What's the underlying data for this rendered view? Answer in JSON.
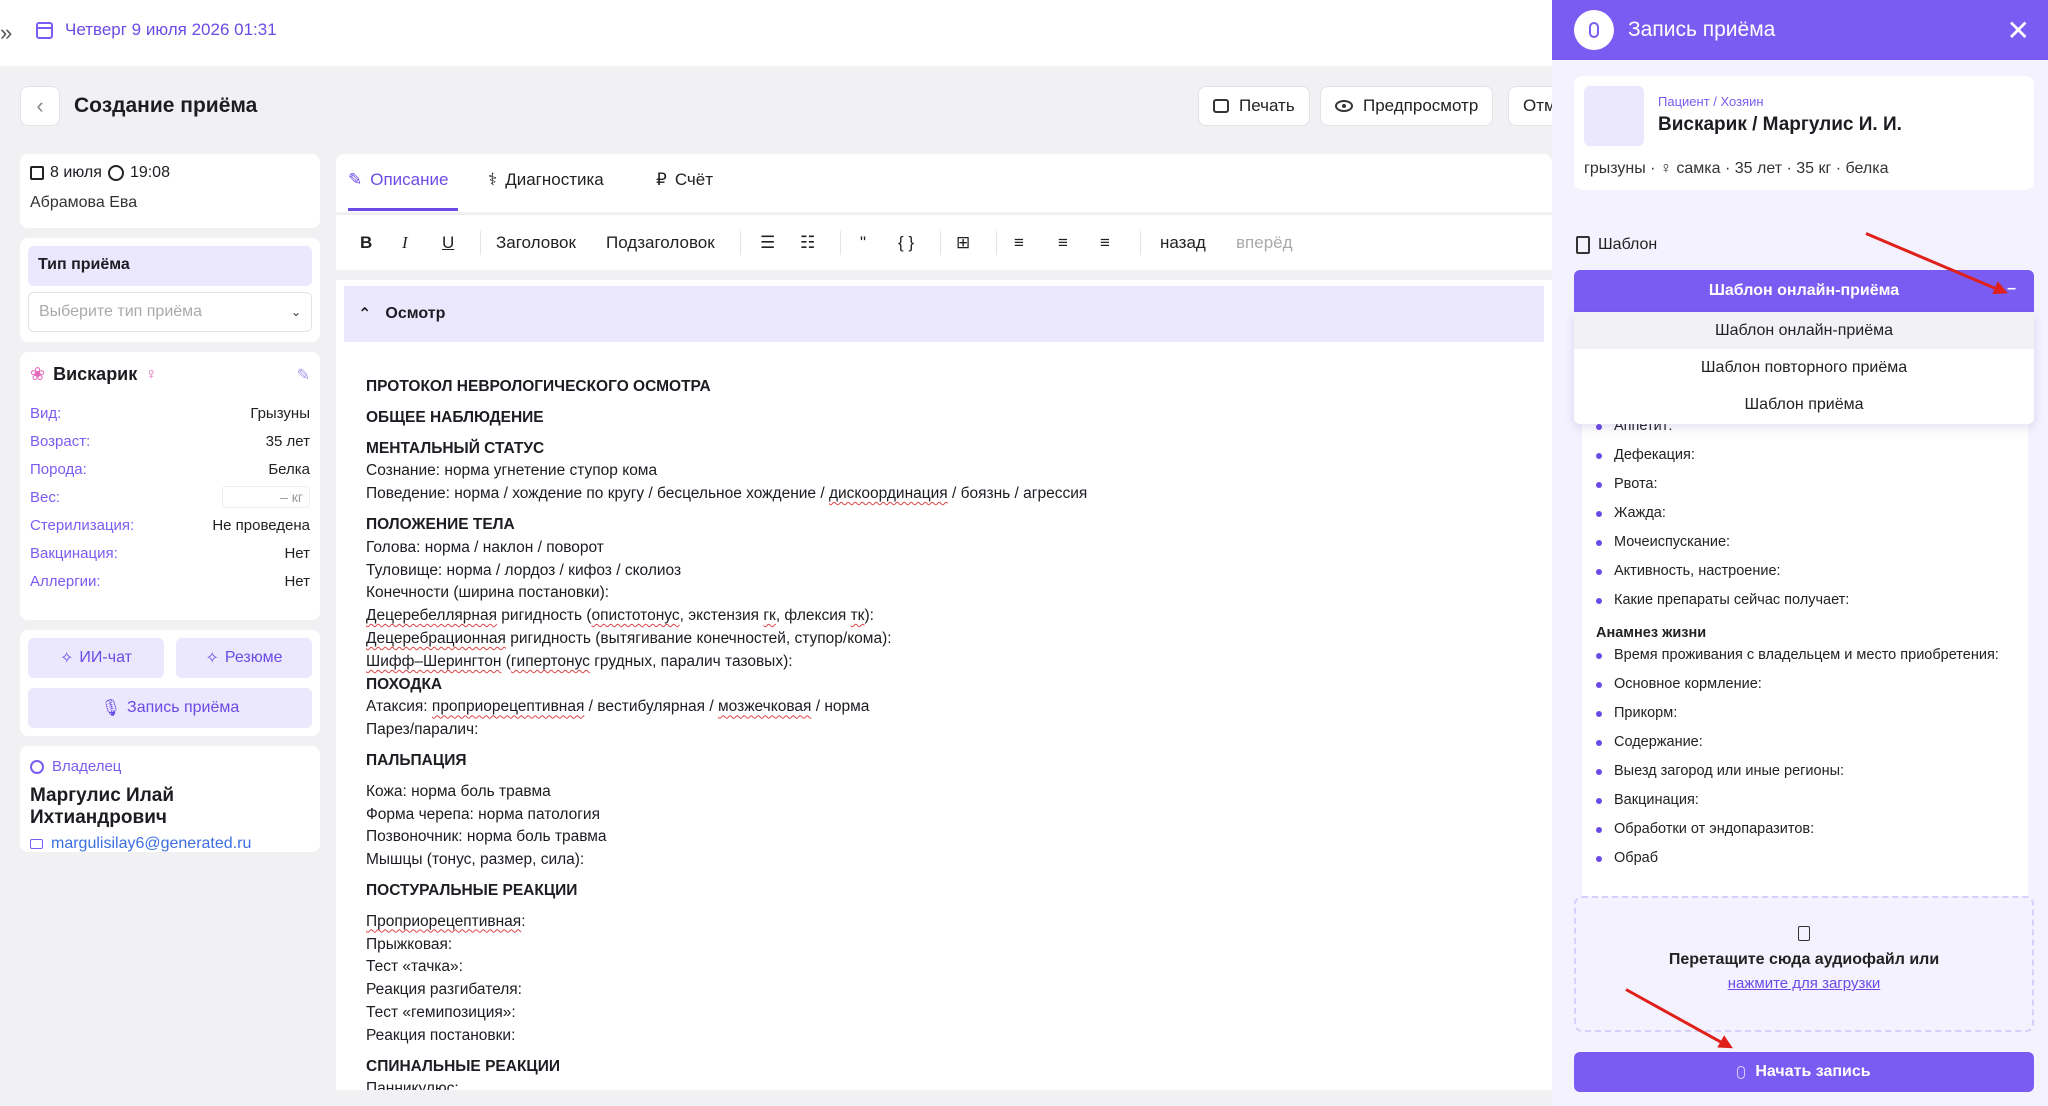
{
  "topbar": {
    "expand": "»",
    "date": "Четверг 9 июля 2026 01:31"
  },
  "header": {
    "title": "Создание приёма",
    "print": "Печать",
    "preview": "Предпросмотр",
    "cancel": "Отм"
  },
  "visit": {
    "date": "8 июля",
    "time": "19:08",
    "doctor": "Абрамова Ева"
  },
  "visit_type": {
    "label": "Тип приёма",
    "placeholder": "Выберите тип приёма"
  },
  "pet": {
    "name": "Вискарик",
    "gender": "♀",
    "rows": [
      {
        "k": "Вид:",
        "v": "Грызуны"
      },
      {
        "k": "Возраст:",
        "v": "35 лет"
      },
      {
        "k": "Порода:",
        "v": "Белка"
      },
      {
        "k": "Вес:",
        "v": ""
      },
      {
        "k": "Стерилизация:",
        "v": "Не проведена"
      },
      {
        "k": "Вакцинация:",
        "v": "Нет"
      },
      {
        "k": "Аллергии:",
        "v": "Нет"
      }
    ],
    "weight_input": "– кг"
  },
  "actions": {
    "ai_chat": "ИИ-чат",
    "resume": "Резюме",
    "record": "Запись приёма"
  },
  "owner": {
    "label": "Владелец",
    "name": "Маргулис Илай Ихтиандрович",
    "email": "margulisilay6@generated.ru"
  },
  "tabs": {
    "description": "Описание",
    "diagnostics": "Диагностика",
    "invoice": "Счёт"
  },
  "toolbar": {
    "bold": "B",
    "italic": "I",
    "underline": "U",
    "heading": "Заголовок",
    "subheading": "Подзаголовок",
    "bullets": "☰",
    "numbered": "☷",
    "quote": "\"",
    "code": "{ }",
    "table": "⊞",
    "align_left": "≡",
    "align_center": "≡",
    "align_right": "≡",
    "undo": "назад",
    "redo": "вперёд"
  },
  "section": {
    "title": "Осмотр"
  },
  "doc": {
    "l1": "ПРОТОКОЛ НЕВРОЛОГИЧЕСКОГО ОСМОТРА",
    "l2": "ОБЩЕЕ НАБЛЮДЕНИЕ",
    "l3": "МЕНТАЛЬНЫЙ СТАТУС",
    "l4": "Сознание: норма угнетение ступор кома",
    "l5a": "Поведение: норма / хождение по кругу / бесцельное хождение / ",
    "l5b": "дискоординация",
    "l5c": " / боязнь / агрессия",
    "l6": "ПОЛОЖЕНИЕ ТЕЛА",
    "l7": "Голова: норма / наклон / поворот",
    "l8": "Туловище: норма / лордоз / кифоз / сколиоз",
    "l9": "Конечности (ширина постановки):",
    "l10a": "Децеребеллярная",
    "l10b": " ригидность (",
    "l10c": "опистотонус",
    "l10d": ", экстензия ",
    "l10e": "гк",
    "l10f": ", флексия ",
    "l10g": "тк",
    "l10h": "):",
    "l11a": "Децеребрационная",
    "l11b": " ригидность (вытягивание конечностей, ступор/кома):",
    "l12a": "Шифф–Шерингтон",
    "l12b": " (",
    "l12c": "гипертонус",
    "l12d": " грудных, паралич тазовых):",
    "l13": "ПОХОДКА",
    "l14a": "Атаксия: ",
    "l14b": "проприорецептивная",
    "l14c": " / вестибулярная / ",
    "l14d": "мозжечковая",
    "l14e": " / норма",
    "l15": "Парез/паралич:",
    "l16": "ПАЛЬПАЦИЯ",
    "l17": "Кожа: норма боль травма",
    "l18": "Форма черепа: норма патология",
    "l19": "Позвоночник: норма боль травма",
    "l20": "Мышцы (тонус, размер, сила):",
    "l21": "ПОСТУРАЛЬНЫЕ РЕАКЦИИ",
    "l22": "Проприорецептивная",
    "l22b": ":",
    "l23": "Прыжковая:",
    "l24": "Тест «тачка»:",
    "l25": "Реакция разгибателя:",
    "l26": "Тест «гемипозиция»:",
    "l27": "Реакция постановки:",
    "l28": "СПИНАЛЬНЫЕ РЕАКЦИИ",
    "l29": "Панникулюс:"
  },
  "panel": {
    "title": "Запись приёма",
    "close": "✕",
    "patient_label": "Пациент / Хозяин",
    "patient_name": "Вискарик / Маргулис И. И.",
    "patient_info_a": "грызуны · ",
    "patient_info_b": "♀",
    "patient_info_c": " самка · 35 лет · 35 кг · белка",
    "template_label": "Шаблон",
    "template_selected": "Шаблон онлайн-приёма",
    "template_toggle": "–",
    "options": [
      "Шаблон онлайн-приёма",
      "Шаблон повторного приёма",
      "Шаблон приёма"
    ],
    "list_a": [
      "Аппетит:",
      "Дефекация:",
      "Рвота:",
      "Жажда:",
      "Мочеиспускание:",
      "Активность, настроение:",
      "Какие препараты сейчас получает:"
    ],
    "group": "Анамнез жизни",
    "list_b": [
      "Время проживания с владельцем и место приобретения:",
      "Основное кормление:",
      "Прикорм:",
      "Содержание:",
      "Выезд загород или иные регионы:",
      "Вакцинация:",
      "Обработки от эндопаразитов:",
      "Обраб"
    ],
    "drop_text": "Перетащите сюда аудиофайл или",
    "drop_link": "нажмите для загрузки",
    "start": "Начать запись"
  }
}
